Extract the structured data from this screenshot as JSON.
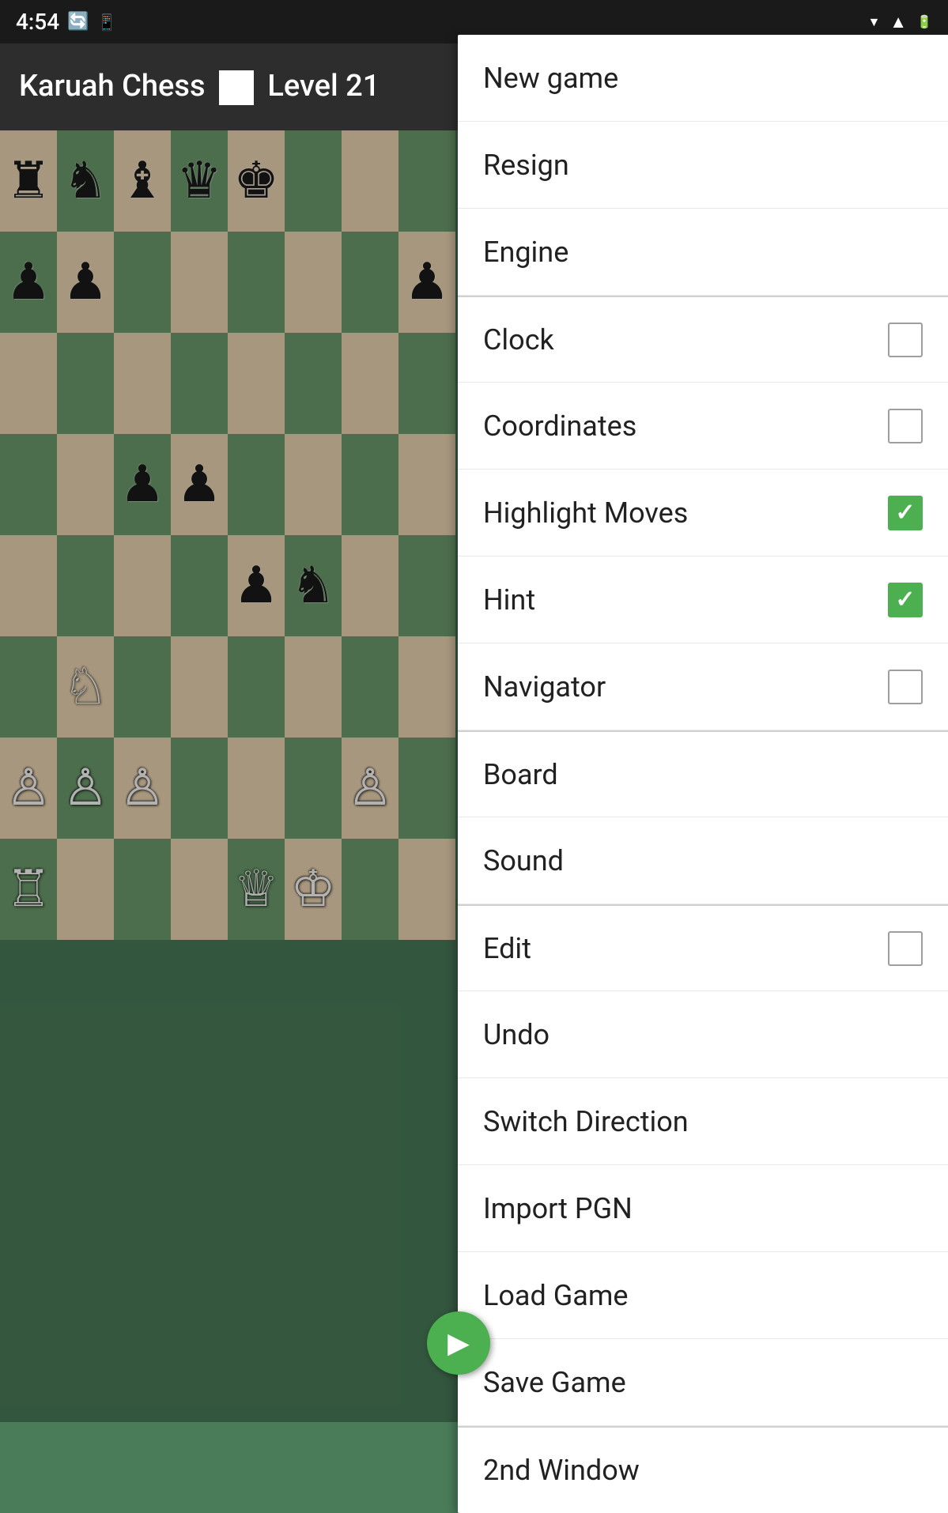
{
  "statusBar": {
    "time": "4:54",
    "icons": [
      "sync",
      "sim",
      "wifi",
      "signal",
      "battery"
    ]
  },
  "appBar": {
    "title": "Karuah Chess",
    "levelLabel": "Level 21"
  },
  "board": {
    "accent": "#6e9e6e",
    "pieces": [
      [
        "♜",
        "♞",
        "♝",
        "♛",
        "♚",
        "",
        "",
        ""
      ],
      [
        "♟",
        "♟",
        "",
        "",
        "",
        "",
        "",
        "♟"
      ],
      [
        "",
        "",
        "",
        "",
        "",
        "",
        "",
        ""
      ],
      [
        "",
        "",
        "♟",
        "♟",
        "",
        "",
        "",
        ""
      ],
      [
        "",
        "",
        "",
        "",
        "♟",
        "♞",
        "",
        ""
      ],
      [
        "",
        "♘",
        "",
        "",
        "",
        "",
        "",
        ""
      ],
      [
        "♙",
        "♙",
        "♙",
        "",
        "",
        "",
        "♙",
        ""
      ],
      [
        "♖",
        "",
        "",
        "",
        "♕",
        "♔",
        "",
        ""
      ]
    ]
  },
  "menu": {
    "items": [
      {
        "id": "new-game",
        "label": "New game",
        "hasCheckbox": false,
        "checked": false,
        "hasSeparatorAbove": false
      },
      {
        "id": "resign",
        "label": "Resign",
        "hasCheckbox": false,
        "checked": false,
        "hasSeparatorAbove": false
      },
      {
        "id": "engine",
        "label": "Engine",
        "hasCheckbox": false,
        "checked": false,
        "hasSeparatorAbove": false
      },
      {
        "id": "clock",
        "label": "Clock",
        "hasCheckbox": true,
        "checked": false,
        "hasSeparatorAbove": true
      },
      {
        "id": "coordinates",
        "label": "Coordinates",
        "hasCheckbox": true,
        "checked": false,
        "hasSeparatorAbove": false
      },
      {
        "id": "highlight-moves",
        "label": "Highlight Moves",
        "hasCheckbox": true,
        "checked": true,
        "hasSeparatorAbove": false
      },
      {
        "id": "hint",
        "label": "Hint",
        "hasCheckbox": true,
        "checked": true,
        "hasSeparatorAbove": false
      },
      {
        "id": "navigator",
        "label": "Navigator",
        "hasCheckbox": true,
        "checked": false,
        "hasSeparatorAbove": false
      },
      {
        "id": "board",
        "label": "Board",
        "hasCheckbox": false,
        "checked": false,
        "hasSeparatorAbove": true
      },
      {
        "id": "sound",
        "label": "Sound",
        "hasCheckbox": false,
        "checked": false,
        "hasSeparatorAbove": false
      },
      {
        "id": "edit",
        "label": "Edit",
        "hasCheckbox": true,
        "checked": false,
        "hasSeparatorAbove": true
      },
      {
        "id": "undo",
        "label": "Undo",
        "hasCheckbox": false,
        "checked": false,
        "hasSeparatorAbove": false
      },
      {
        "id": "switch-direction",
        "label": "Switch Direction",
        "hasCheckbox": false,
        "checked": false,
        "hasSeparatorAbove": false
      },
      {
        "id": "import-pgn",
        "label": "Import PGN",
        "hasCheckbox": false,
        "checked": false,
        "hasSeparatorAbove": false
      },
      {
        "id": "load-game",
        "label": "Load Game",
        "hasCheckbox": false,
        "checked": false,
        "hasSeparatorAbove": false
      },
      {
        "id": "save-game",
        "label": "Save Game",
        "hasCheckbox": false,
        "checked": false,
        "hasSeparatorAbove": false
      },
      {
        "id": "2nd-window",
        "label": "2nd Window",
        "hasCheckbox": false,
        "checked": false,
        "hasSeparatorAbove": true
      }
    ]
  }
}
